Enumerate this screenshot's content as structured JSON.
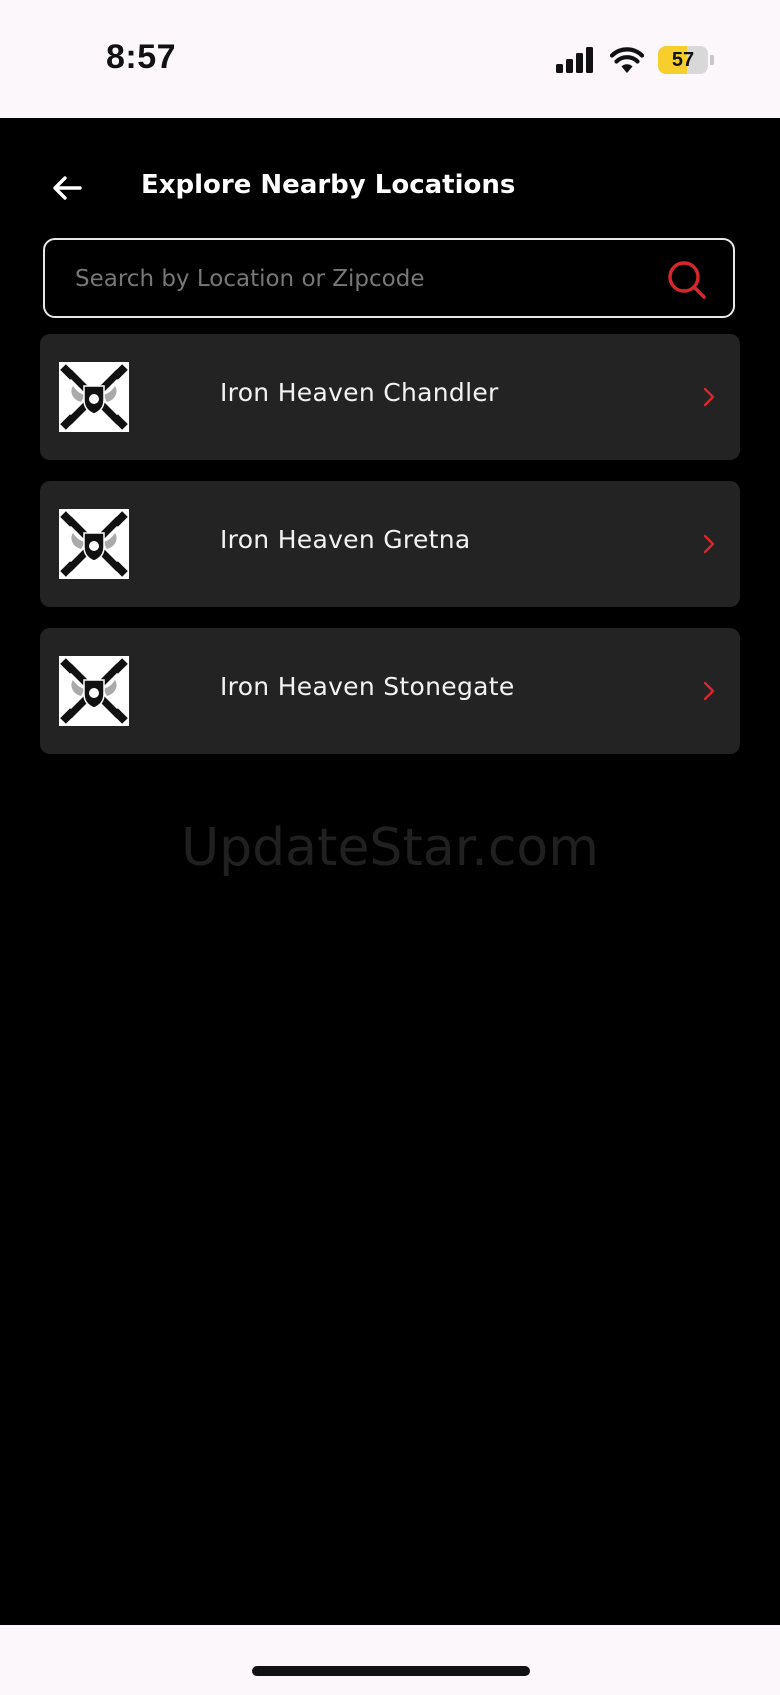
{
  "status_bar": {
    "time": "8:57",
    "battery_level": "57",
    "battery_percent": 57,
    "icons": [
      "signal-icon",
      "wifi-icon",
      "battery-icon"
    ]
  },
  "header": {
    "title": "Explore Nearby Locations",
    "back_icon": "arrow-left-icon"
  },
  "search": {
    "value": "",
    "placeholder": "Search by Location or Zipcode",
    "icon": "search-icon"
  },
  "locations": [
    {
      "name": "Iron Heaven Chandler",
      "logo": "gym-logo-icon",
      "chevron": "chevron-right-icon"
    },
    {
      "name": "Iron Heaven Gretna",
      "logo": "gym-logo-icon",
      "chevron": "chevron-right-icon"
    },
    {
      "name": "Iron Heaven Stonegate",
      "logo": "gym-logo-icon",
      "chevron": "chevron-right-icon"
    }
  ],
  "watermark": "UpdateStar.com",
  "colors": {
    "accent": "#d8262c",
    "background": "#000000",
    "card": "#232323",
    "text": "#ffffff",
    "battery": "#f7cf2c"
  }
}
